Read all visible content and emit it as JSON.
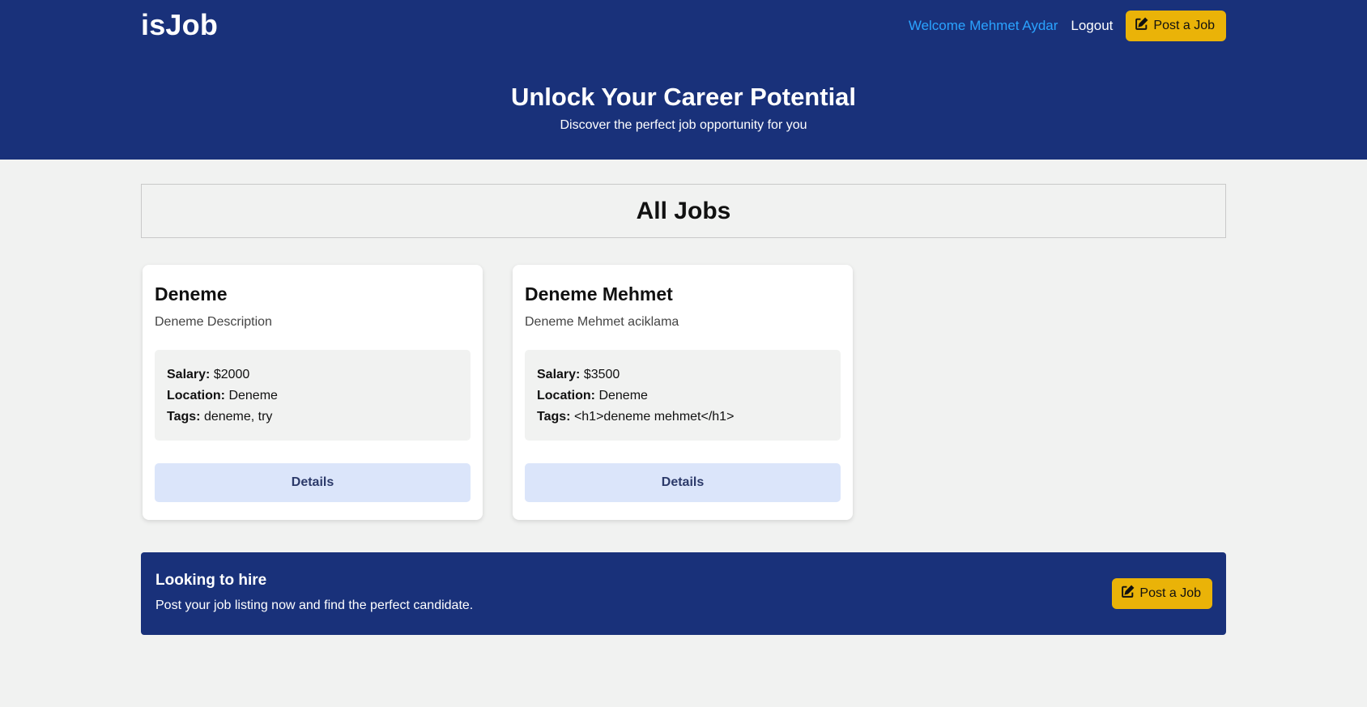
{
  "nav": {
    "brand": "isJob",
    "welcome": "Welcome Mehmet Aydar",
    "logout": "Logout",
    "post_job_label": "Post a Job"
  },
  "hero": {
    "title": "Unlock Your Career Potential",
    "subtitle": "Discover the perfect job opportunity for you"
  },
  "jobs_section": {
    "title": "All Jobs",
    "salary_label": "Salary:",
    "location_label": "Location:",
    "tags_label": "Tags:",
    "details_label": "Details",
    "jobs": [
      {
        "title": "Deneme",
        "description": "Deneme Description",
        "salary": "$2000",
        "location": "Deneme",
        "tags": "deneme, try"
      },
      {
        "title": "Deneme Mehmet",
        "description": "Deneme Mehmet aciklama",
        "salary": "$3500",
        "location": "Deneme",
        "tags": "<h1>deneme mehmet</h1>"
      }
    ]
  },
  "cta": {
    "title": "Looking to hire",
    "text": "Post your job listing now and find the perfect candidate.",
    "post_job_label": "Post a Job"
  },
  "colors": {
    "primary": "#19317a",
    "accent": "#eab308",
    "welcome_text": "#2aa3ff",
    "details_bg": "#dbe5fa",
    "page_bg": "#f1f2f1"
  },
  "icons": {
    "post_job": "pen-to-square-icon"
  }
}
